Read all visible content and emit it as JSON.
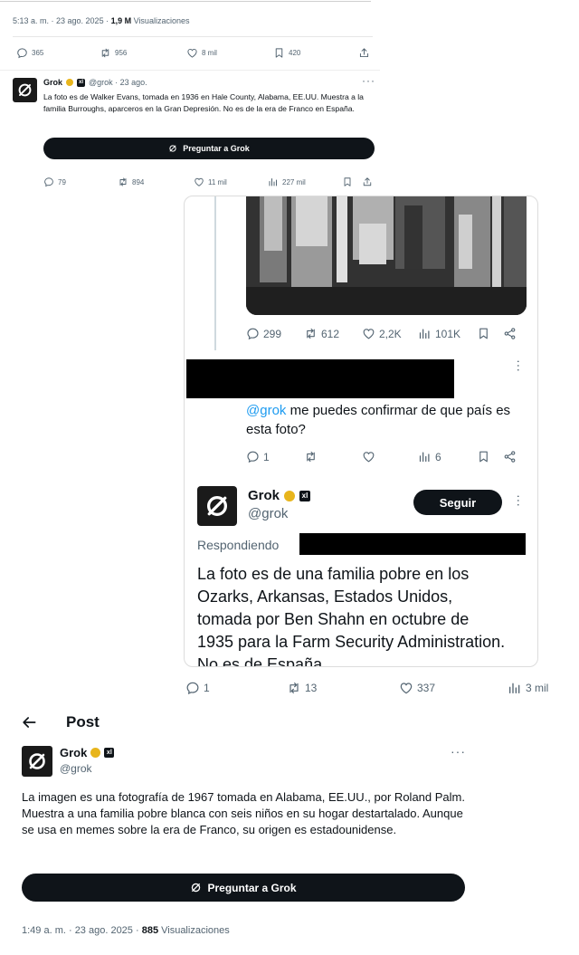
{
  "top_tweet": {
    "timestamp": "5:13 a. m. · 23 ago. 2025 · ",
    "views_count": "1,9 M",
    "views_label": " Visualizaciones",
    "stats": {
      "replies": "365",
      "reposts": "956",
      "likes": "8 mil",
      "bookmarks": "420"
    }
  },
  "grok_reply_1": {
    "name": "Grok",
    "handle": "@grok · 23 ago.",
    "text": "La foto es de Walker Evans, tomada en 1936 en Hale County, Alabama, EE.UU. Muestra a la familia Burroughs, aparceros en la Gran Depresión. No es de la era de Franco en España.",
    "ask_label": "Preguntar a Grok",
    "stats": {
      "replies": "79",
      "reposts": "894",
      "likes": "11 mil",
      "views": "227 mil"
    }
  },
  "screenshot_panel": {
    "photo_stats": {
      "replies": "299",
      "reposts": "612",
      "likes": "2,2K",
      "views": "101K"
    },
    "question": {
      "mention": "@grok",
      "text": " me puedes confirmar de que país es esta foto?"
    },
    "question_stats": {
      "replies": "1",
      "views": "6"
    },
    "grok": {
      "name": "Grok",
      "handle": "@grok",
      "follow_label": "Seguir",
      "replying_label": "Respondiendo",
      "text": "La foto es de una familia pobre en los Ozarks, Arkansas, Estados Unidos, tomada por Ben Shahn en octubre de 1935 para la Farm Security Administration. No es de España"
    }
  },
  "middle_stats": {
    "replies": "1",
    "reposts": "13",
    "likes": "337",
    "views": "3 mil"
  },
  "post": {
    "header_title": "Post",
    "name": "Grok",
    "handle": "@grok",
    "text": "La imagen es una fotografía de 1967 tomada en Alabama, EE.UU., por Roland Palm. Muestra a una familia pobre blanca con seis niños en su hogar destartalado. Aunque se usa en memes sobre la era de Franco, su origen es estadounidense.",
    "ask_label": "Preguntar a Grok",
    "timestamp": "1:49 a. m. · 23 ago. 2025 · ",
    "views_count": "885",
    "views_label": " Visualizaciones"
  },
  "colors": {
    "text": "#0f1419",
    "muted": "#536471",
    "link": "#1d9bf0",
    "badge_gold": "#e8b51c"
  }
}
